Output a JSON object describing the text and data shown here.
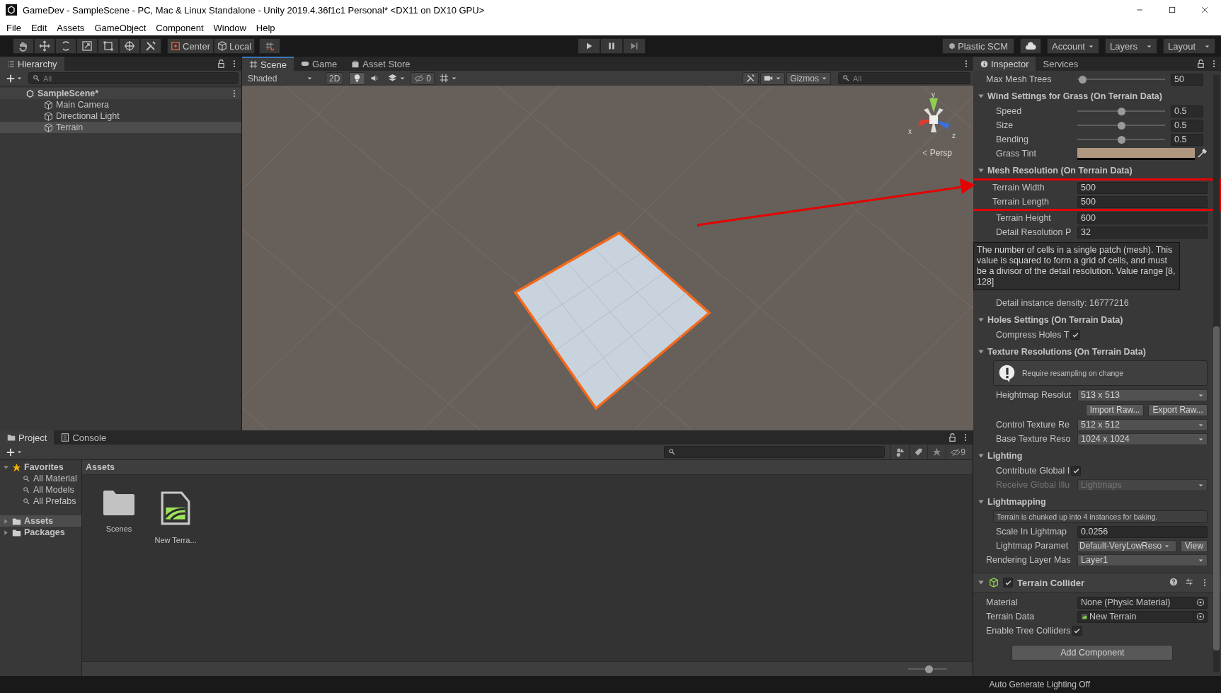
{
  "window": {
    "title": "GameDev - SampleScene - PC, Mac & Linux Standalone - Unity 2019.4.36f1c1 Personal* <DX11 on DX10 GPU>"
  },
  "menu": [
    "File",
    "Edit",
    "Assets",
    "GameObject",
    "Component",
    "Window",
    "Help"
  ],
  "toolbar": {
    "pivot": "Center",
    "space": "Local",
    "plastic": "Plastic SCM",
    "account": "Account",
    "layers": "Layers",
    "layout": "Layout"
  },
  "hierarchy": {
    "tab": "Hierarchy",
    "search_placeholder": "All",
    "scene": "SampleScene*",
    "objects": [
      {
        "name": "Main Camera",
        "selected": false
      },
      {
        "name": "Directional Light",
        "selected": false
      },
      {
        "name": "Terrain",
        "selected": true
      }
    ]
  },
  "scene_view": {
    "toggles": [
      {
        "on": true
      },
      {
        "on": false
      },
      {
        "on": false
      },
      {
        "on": false
      }
    ],
    "tabs": [
      {
        "label": "Scene",
        "selected": true
      },
      {
        "label": "Game",
        "selected": false
      },
      {
        "label": "Asset Store",
        "selected": false
      }
    ],
    "shading": "Shaded",
    "mode_2d": "2D",
    "hidden_count": "0",
    "gizmos": "Gizmos",
    "search_placeholder": "All",
    "axes": [
      "y",
      "x",
      "z"
    ],
    "projection": "Persp"
  },
  "inspector": {
    "tabs": [
      {
        "label": "Inspector",
        "selected": true
      },
      {
        "label": "Services",
        "selected": false
      }
    ],
    "rows": [
      {
        "kind": "slider",
        "label": "Max Mesh Trees",
        "level": 0.02,
        "value": "50"
      },
      {
        "kind": "header",
        "label": "Wind Settings for Grass (On Terrain Data)",
        "expanded": true,
        "children": [
          {
            "kind": "slider",
            "label": "Speed",
            "level": 0.5,
            "value": "0.5"
          },
          {
            "kind": "slider",
            "label": "Size",
            "level": 0.5,
            "value": "0.5"
          },
          {
            "kind": "slider",
            "label": "Bending",
            "level": 0.5,
            "value": "0.5"
          },
          {
            "kind": "color",
            "label": "Grass Tint",
            "color": "#b0977f"
          }
        ]
      },
      {
        "kind": "header",
        "label": "Mesh Resolution (On Terrain Data)",
        "expanded": true,
        "children": [
          {
            "kind": "highlight",
            "rows": [
              {
                "kind": "field",
                "label": "Terrain Width",
                "value": "500"
              },
              {
                "kind": "field",
                "label": "Terrain Length",
                "value": "500"
              }
            ]
          },
          {
            "kind": "field",
            "label": "Terrain Height",
            "value": "600"
          },
          {
            "kind": "field",
            "label": "Detail Resolution P",
            "value": "32"
          },
          {
            "kind": "tooltip",
            "text": "The number of cells in a single patch (mesh). This value is squared to form a grid of cells, and must be a divisor of the detail resolution. Value range [8, 128]"
          },
          {
            "kind": "info",
            "text": "Detail instance density: 16777216"
          }
        ]
      },
      {
        "kind": "header",
        "label": "Holes Settings (On Terrain Data)",
        "expanded": true,
        "children": [
          {
            "kind": "checkbox",
            "label": "Compress Holes T",
            "checked": true
          }
        ]
      },
      {
        "kind": "header",
        "label": "Texture Resolutions (On Terrain Data)",
        "expanded": true,
        "children": [
          {
            "kind": "helpbox",
            "text": "Require resampling on change"
          },
          {
            "kind": "dropdown",
            "label": "Heightmap Resolut",
            "value": "513 x 513",
            "disabled": false
          },
          {
            "kind": "buttons",
            "buttons": [
              "Import Raw...",
              "Export Raw..."
            ]
          },
          {
            "kind": "dropdown",
            "label": "Control Texture Re",
            "value": "512 x 512",
            "disabled": false
          },
          {
            "kind": "dropdown",
            "label": "Base Texture Reso",
            "value": "1024 x 1024",
            "disabled": false
          }
        ]
      },
      {
        "kind": "header",
        "label": "Lighting",
        "expanded": true,
        "children": [
          {
            "kind": "checkbox",
            "label": "Contribute Global I",
            "checked": true
          },
          {
            "kind": "dropdown",
            "label": "Receive Global Illu",
            "value": "Lightmaps",
            "disabled": true
          }
        ]
      },
      {
        "kind": "header",
        "label": "Lightmapping",
        "expanded": true,
        "children": [
          {
            "kind": "note",
            "text": "Terrain is chunked up into 4 instances for baking."
          },
          {
            "kind": "field",
            "label": "Scale In Lightmap",
            "value": "0.0256"
          },
          {
            "kind": "dropdown_button",
            "label": "Lightmap Paramet",
            "value": "Default-VeryLowReso",
            "button": "View"
          }
        ]
      },
      {
        "kind": "dropdown",
        "label": "Rendering Layer Mas",
        "value": "Layer1",
        "disabled": false
      },
      {
        "kind": "component",
        "label": "Terrain Collider",
        "enabled": true,
        "expanded": true,
        "children": [
          {
            "kind": "object",
            "label": "Material",
            "value": "None (Physic Material)",
            "asset": false
          },
          {
            "kind": "object",
            "label": "Terrain Data",
            "value": "New Terrain",
            "asset": true
          },
          {
            "kind": "checkbox",
            "label": "Enable Tree Colliders",
            "checked": true
          }
        ]
      },
      {
        "kind": "add_component",
        "label": "Add Component"
      }
    ]
  },
  "project": {
    "tabs": [
      {
        "label": "Project",
        "selected": true
      },
      {
        "label": "Console",
        "selected": false
      }
    ],
    "hidden_count": "9",
    "favorites": {
      "label": "Favorites",
      "searches": [
        "All Material",
        "All Models",
        "All Prefabs"
      ]
    },
    "folders": [
      {
        "name": "Assets",
        "selected": true
      },
      {
        "name": "Packages",
        "selected": false
      }
    ],
    "breadcrumb": "Assets",
    "zoom_slider": {
      "level": 0.55
    },
    "items": [
      {
        "kind": "folder",
        "name": "Scenes"
      },
      {
        "kind": "terrain",
        "name": "New Terra..."
      }
    ]
  },
  "status_bar": {
    "text": "Auto Generate Lighting Off"
  }
}
